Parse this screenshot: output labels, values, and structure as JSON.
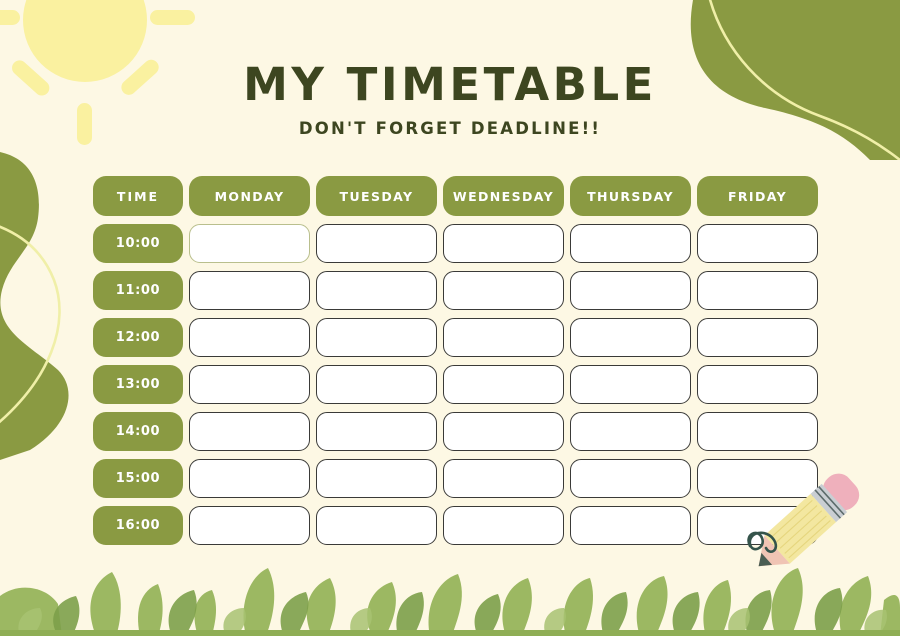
{
  "header": {
    "title": "MY TIMETABLE",
    "subtitle": "DON'T FORGET DEADLINE!!"
  },
  "theme": {
    "background": "#fdf8e4",
    "olive": "#8a9a42",
    "title_color": "#3d4620",
    "cell_border": "#3a3a38",
    "active_cell_border": "#b9bf8d",
    "sun_color": "#faf1a0",
    "grass_green": "#8fae55",
    "pencil_body": "#f3e7a0",
    "pencil_eraser": "#efb0bc",
    "doodle_color": "#35544b"
  },
  "timetable": {
    "time_column_header": "TIME",
    "days": [
      "MONDAY",
      "TUESDAY",
      "WEDNESDAY",
      "THURSDAY",
      "FRIDAY"
    ],
    "times": [
      "10:00",
      "11:00",
      "12:00",
      "13:00",
      "14:00",
      "15:00",
      "16:00"
    ],
    "active_cell": {
      "row": 0,
      "day": 0
    },
    "entries": [
      [
        "",
        "",
        "",
        "",
        ""
      ],
      [
        "",
        "",
        "",
        "",
        ""
      ],
      [
        "",
        "",
        "",
        "",
        ""
      ],
      [
        "",
        "",
        "",
        "",
        ""
      ],
      [
        "",
        "",
        "",
        "",
        ""
      ],
      [
        "",
        "",
        "",
        "",
        ""
      ],
      [
        "",
        "",
        "",
        "",
        ""
      ]
    ]
  },
  "decorations": [
    {
      "name": "sun-decoration",
      "position": "top-left"
    },
    {
      "name": "leaf-top-right",
      "position": "top-right"
    },
    {
      "name": "leaf-left",
      "position": "left"
    },
    {
      "name": "pencil-decoration",
      "position": "bottom-right"
    },
    {
      "name": "grass-border",
      "position": "bottom"
    }
  ]
}
